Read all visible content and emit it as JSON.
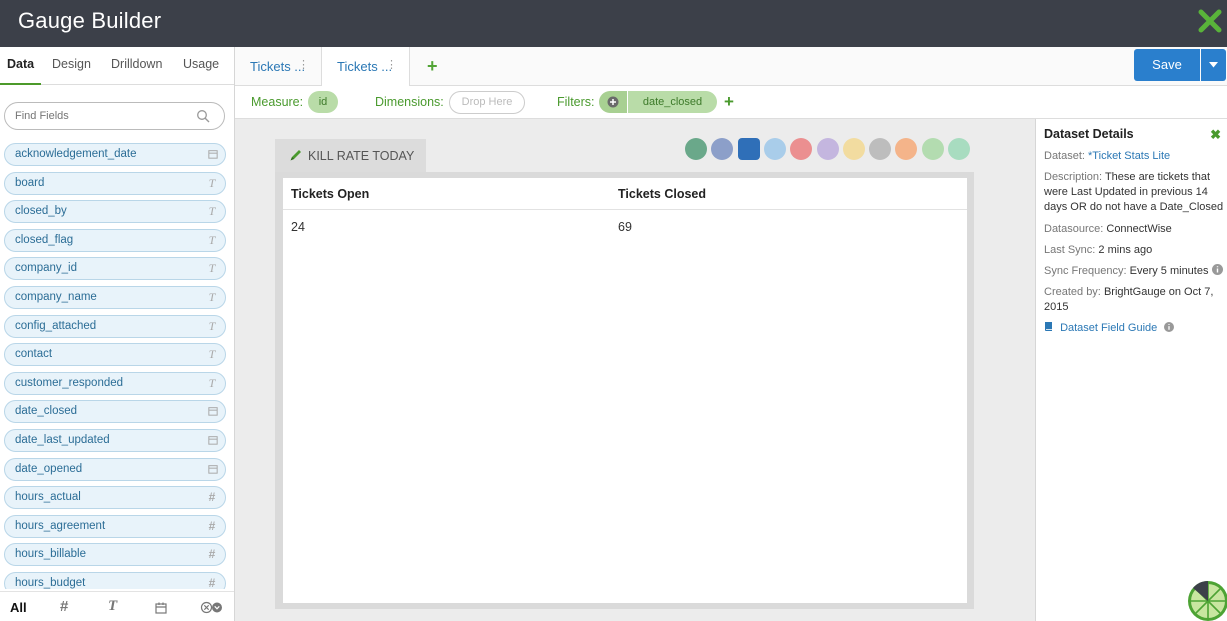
{
  "app": {
    "title": "Gauge Builder"
  },
  "left_panel": {
    "tabs": [
      {
        "label": "Data",
        "active": true
      },
      {
        "label": "Design",
        "active": false
      },
      {
        "label": "Drilldown",
        "active": false
      },
      {
        "label": "Usage",
        "active": false
      }
    ],
    "search": {
      "placeholder": "Find Fields"
    },
    "fields": [
      {
        "name": "acknowledgement_date",
        "type": "date"
      },
      {
        "name": "board",
        "type": "text"
      },
      {
        "name": "closed_by",
        "type": "text"
      },
      {
        "name": "closed_flag",
        "type": "text"
      },
      {
        "name": "company_id",
        "type": "text"
      },
      {
        "name": "company_name",
        "type": "text"
      },
      {
        "name": "config_attached",
        "type": "text"
      },
      {
        "name": "contact",
        "type": "text"
      },
      {
        "name": "customer_responded",
        "type": "text"
      },
      {
        "name": "date_closed",
        "type": "date"
      },
      {
        "name": "date_last_updated",
        "type": "date"
      },
      {
        "name": "date_opened",
        "type": "date"
      },
      {
        "name": "hours_actual",
        "type": "number"
      },
      {
        "name": "hours_agreement",
        "type": "number"
      },
      {
        "name": "hours_billable",
        "type": "number"
      },
      {
        "name": "hours_budget",
        "type": "number"
      }
    ],
    "bottom_filters": {
      "all": "All",
      "number": "#",
      "text": "T"
    }
  },
  "sheet_tabs": [
    {
      "label": "Tickets ...",
      "active": false
    },
    {
      "label": "Tickets ...",
      "active": true
    }
  ],
  "toolbar": {
    "save_label": "Save"
  },
  "measure_bar": {
    "measure_label": "Measure:",
    "measure_value": "id",
    "dimensions_label": "Dimensions:",
    "dimensions_placeholder": "Drop Here",
    "filters_label": "Filters:",
    "filter_value": "date_closed"
  },
  "gauge": {
    "title": "KILL RATE TODAY",
    "table": {
      "headers": [
        "Tickets Open",
        "Tickets Closed"
      ],
      "rows": [
        [
          "24",
          "69"
        ]
      ]
    },
    "chart_type_icons": [
      {
        "name": "filter-icon",
        "color": "#6aa88a"
      },
      {
        "name": "camera-icon",
        "color": "#8c9fc9"
      },
      {
        "name": "table-icon",
        "color": "#2f6fb8"
      },
      {
        "name": "bar-chart-icon",
        "color": "#a9cdea"
      },
      {
        "name": "line-chart-icon",
        "color": "#eb8f90"
      },
      {
        "name": "list-chart-icon",
        "color": "#c4b6df"
      },
      {
        "name": "pie-chart-icon",
        "color": "#f2dca0"
      },
      {
        "name": "number-icon",
        "color": "#bdbdbd"
      },
      {
        "name": "gauge-icon",
        "color": "#f4b48a"
      },
      {
        "name": "window-icon",
        "color": "#b3dcb0"
      },
      {
        "name": "trophy-icon",
        "color": "#a8dcc0"
      }
    ]
  },
  "dataset_details": {
    "title": "Dataset Details",
    "dataset_label": "Dataset:",
    "dataset_value": "*Ticket Stats Lite",
    "description_label": "Description:",
    "description_value": "These are tickets that were Last Updated in previous 14 days OR do not have a Date_Closed",
    "datasource_label": "Datasource:",
    "datasource_value": "ConnectWise",
    "last_sync_label": "Last Sync:",
    "last_sync_value": "2 mins ago",
    "sync_frequency_label": "Sync Frequency:",
    "sync_frequency_value": "Every 5 minutes",
    "created_by_label": "Created by:",
    "created_by_value": "BrightGauge on Oct 7, 2015",
    "guide_link": "Dataset Field Guide"
  }
}
